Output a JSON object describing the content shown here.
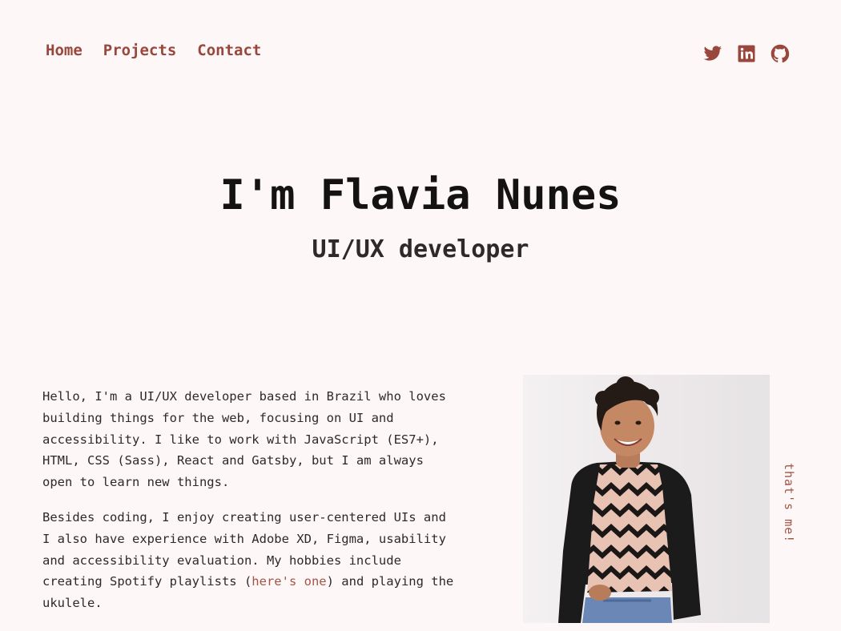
{
  "nav": {
    "items": [
      {
        "label": "Home"
      },
      {
        "label": "Projects"
      },
      {
        "label": "Contact"
      }
    ]
  },
  "socials": {
    "icons": [
      "twitter-icon",
      "linkedin-icon",
      "github-icon"
    ],
    "color": "#99473c"
  },
  "hero": {
    "title": "I'm Flavia Nunes",
    "subtitle": "UI/UX developer"
  },
  "about": {
    "paragraph1": "Hello, I'm a UI/UX developer based in Brazil who loves building things for the web, focusing on UI and accessibility. I like to work with JavaScript (ES7+), HTML, CSS (Sass), React and Gatsby, but I am always open to learn new things.",
    "paragraph2_before": "Besides coding, I enjoy creating user-centered UIs and I also have experience with Adobe XD, Figma, usability and accessibility evaluation. My hobbies include creating Spotify playlists (",
    "paragraph2_link": "here's one",
    "paragraph2_after": ") and playing the ukulele."
  },
  "photo": {
    "caption": "that's me!"
  },
  "colors": {
    "background": "#fdf7f7",
    "accent": "#99473c",
    "text": "#2e2a29"
  }
}
